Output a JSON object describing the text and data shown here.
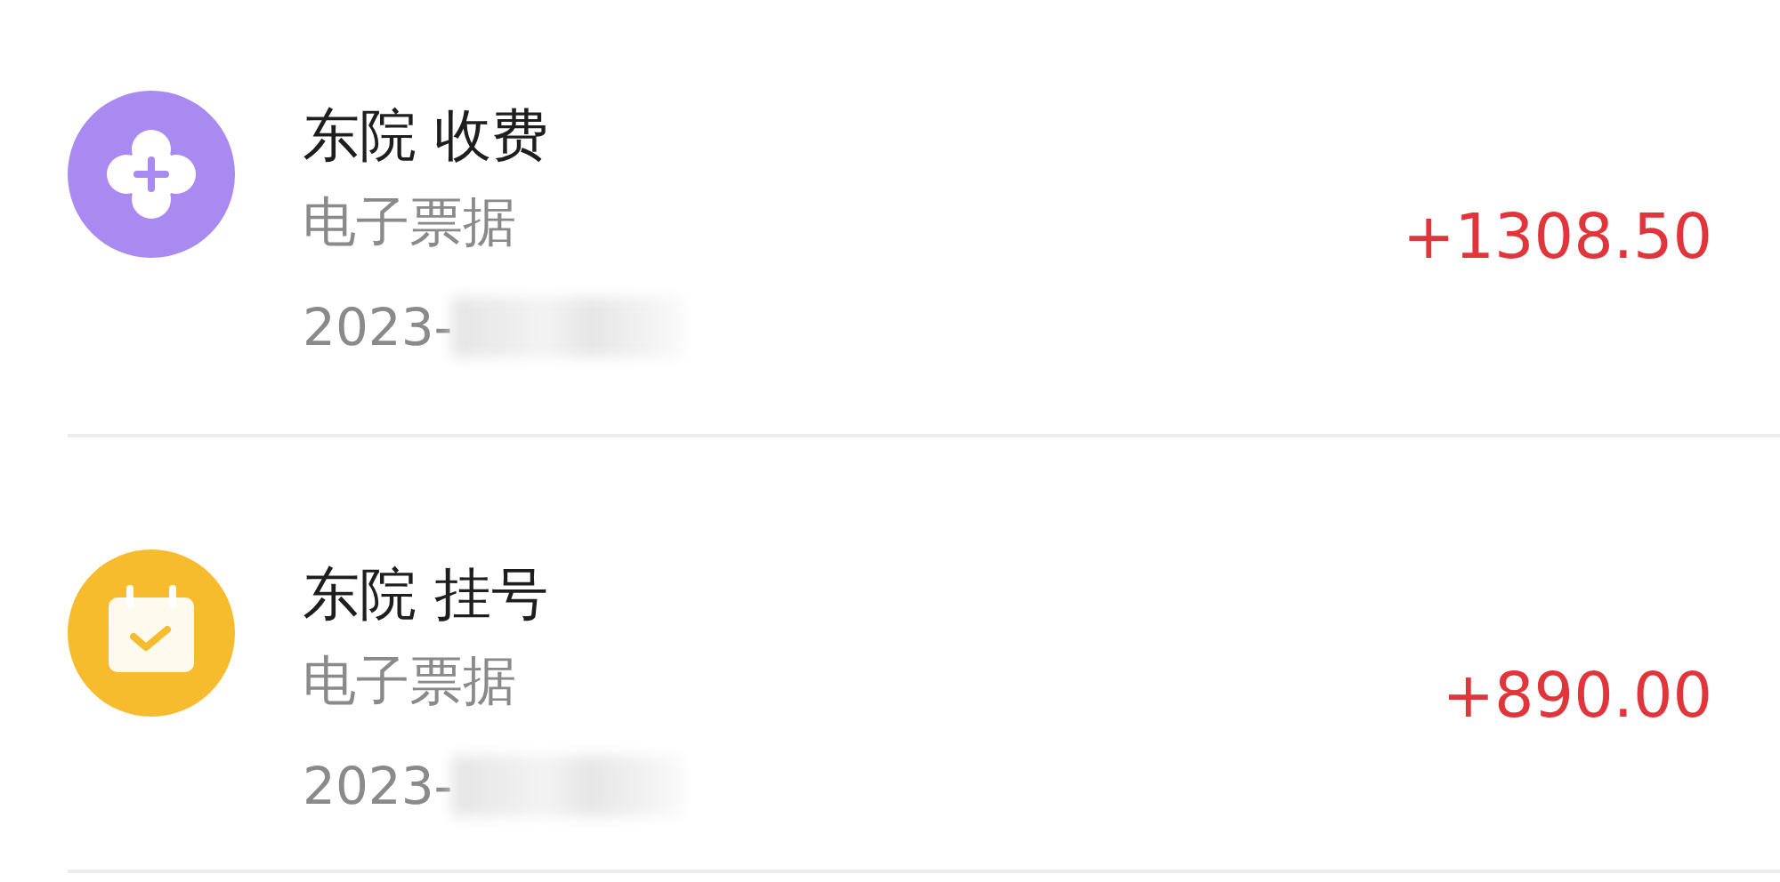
{
  "records": [
    {
      "kind": "clinic",
      "color": "#a98af0",
      "title": "东院 收费",
      "subtitle": "电子票据",
      "date": "2023-",
      "amount": "+1308.50"
    },
    {
      "kind": "calendar",
      "color": "#f7bb2e",
      "title": "东院 挂号",
      "subtitle": "电子票据",
      "date": "2023-",
      "amount": "+890.00"
    }
  ]
}
